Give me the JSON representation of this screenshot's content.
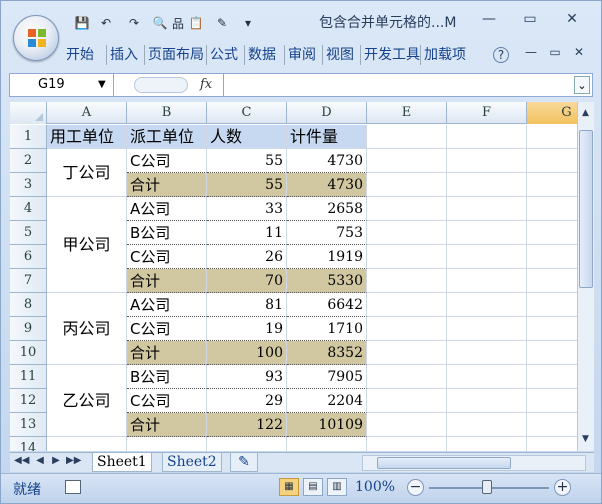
{
  "window": {
    "title": "包含合并单元格的...M"
  },
  "qat": {
    "save": "💾",
    "undo": "↶",
    "redo": "↷",
    "print_preview": "🔍",
    "tree": "品",
    "paste": "📋",
    "brush": "✎",
    "dropdown": "▾"
  },
  "window_buttons": {
    "minimize": "—",
    "restore": "▭",
    "close": "✕"
  },
  "ribbon": {
    "tabs": [
      "开始",
      "插入",
      "页面布局",
      "公式",
      "数据",
      "审阅",
      "视图",
      "开发工具",
      "加载项"
    ],
    "help": "?",
    "min": "—",
    "restore": "▭",
    "close": "✕"
  },
  "formula_bar": {
    "name_box": "G19",
    "fx_label": "fx",
    "content": ""
  },
  "columns": [
    "A",
    "B",
    "C",
    "D",
    "E",
    "F",
    "G"
  ],
  "selected_column": "G",
  "rows": [
    "1",
    "2",
    "3",
    "4",
    "5",
    "6",
    "7",
    "8",
    "9",
    "10",
    "11",
    "12",
    "13",
    "14"
  ],
  "table": {
    "headers": [
      "用工单位",
      "派工单位",
      "人数",
      "计件量"
    ],
    "company_merges": [
      {
        "name": "丁公司",
        "rows": [
          2,
          3
        ]
      },
      {
        "name": "甲公司",
        "rows": [
          4,
          7
        ]
      },
      {
        "name": "丙公司",
        "rows": [
          8,
          10
        ]
      },
      {
        "name": "乙公司",
        "rows": [
          11,
          13
        ]
      }
    ],
    "body": [
      {
        "row": 2,
        "dept": "C公司",
        "people": "55",
        "qty": "4730",
        "total": false
      },
      {
        "row": 3,
        "dept": "合计",
        "people": "55",
        "qty": "4730",
        "total": true
      },
      {
        "row": 4,
        "dept": "A公司",
        "people": "33",
        "qty": "2658",
        "total": false
      },
      {
        "row": 5,
        "dept": "B公司",
        "people": "11",
        "qty": "753",
        "total": false
      },
      {
        "row": 6,
        "dept": "C公司",
        "people": "26",
        "qty": "1919",
        "total": false
      },
      {
        "row": 7,
        "dept": "合计",
        "people": "70",
        "qty": "5330",
        "total": true
      },
      {
        "row": 8,
        "dept": "A公司",
        "people": "81",
        "qty": "6642",
        "total": false
      },
      {
        "row": 9,
        "dept": "C公司",
        "people": "19",
        "qty": "1710",
        "total": false
      },
      {
        "row": 10,
        "dept": "合计",
        "people": "100",
        "qty": "8352",
        "total": true
      },
      {
        "row": 11,
        "dept": "B公司",
        "people": "93",
        "qty": "7905",
        "total": false
      },
      {
        "row": 12,
        "dept": "C公司",
        "people": "29",
        "qty": "2204",
        "total": false
      },
      {
        "row": 13,
        "dept": "合计",
        "people": "122",
        "qty": "10109",
        "total": true
      }
    ]
  },
  "sheets": {
    "tabs": [
      "Sheet1",
      "Sheet2"
    ],
    "active": "Sheet1",
    "insert_icon": "✎"
  },
  "status": {
    "ready": "就绪",
    "zoom": "100%",
    "zoom_out": "−",
    "zoom_in": "+"
  },
  "colors": {
    "header_fill": "#c6d9f1",
    "total_fill": "#d1c8a1",
    "selected_col": "#f1c15f"
  }
}
